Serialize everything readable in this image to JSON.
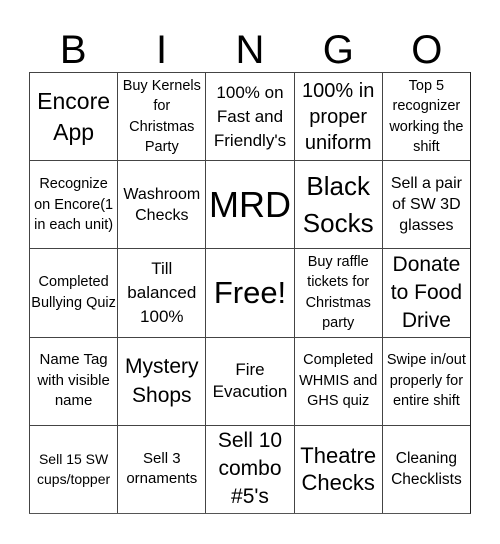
{
  "title_letters": [
    "B",
    "I",
    "N",
    "G",
    "O"
  ],
  "cells": [
    [
      "Encore App",
      "Buy Kernels for Christmas Party",
      "100% on Fast and Friendly's",
      "100% in proper uniform",
      "Top 5 recognizer working the shift"
    ],
    [
      "Recognize on Encore(1 in each unit)",
      "Washroom Checks",
      "MRD",
      "Black Socks",
      "Sell a pair of SW 3D glasses"
    ],
    [
      "Completed Bullying Quiz",
      "Till balanced 100%",
      "Free!",
      "Buy raffle tickets for Christmas party",
      "Donate to Food Drive"
    ],
    [
      "Name Tag with visible name",
      "Mystery Shops",
      "Fire Evacution",
      "Completed WHMIS and GHS quiz",
      "Swipe in/out properly for entire shift"
    ],
    [
      "Sell 15 SW cups/topper",
      "Sell 3 ornaments",
      "Sell 10 combo #5's",
      "Theatre Checks",
      "Cleaning Checklists"
    ]
  ]
}
